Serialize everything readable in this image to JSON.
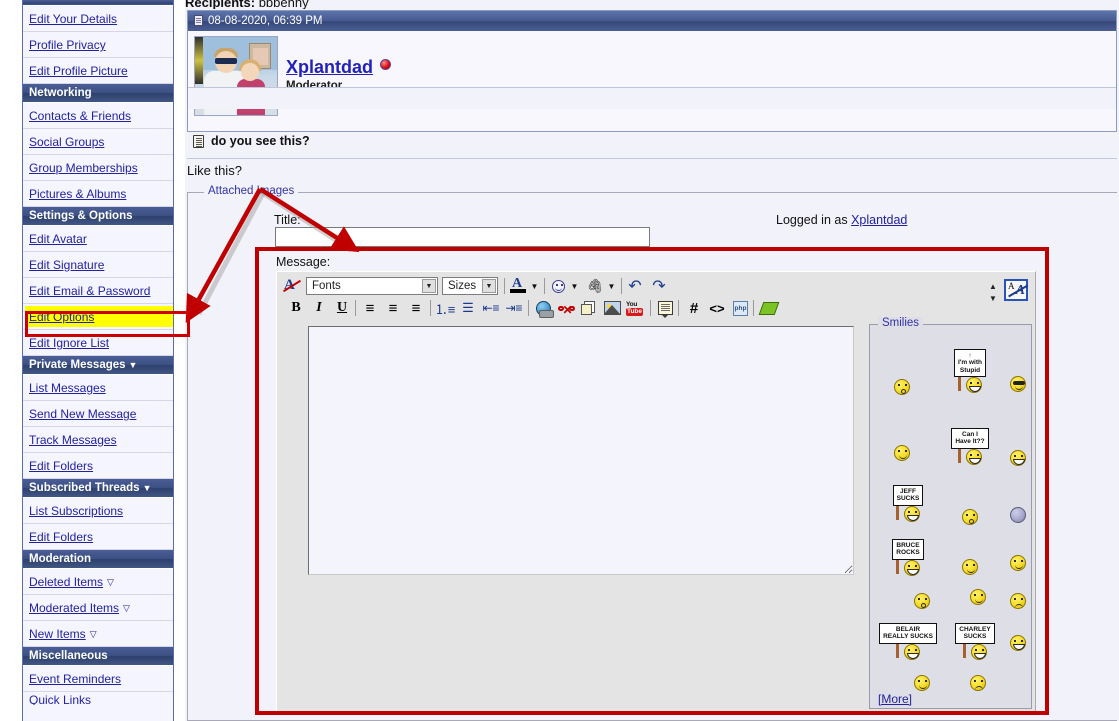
{
  "colors": {
    "nav_header_bg": "#3C5084",
    "link": "#22229C",
    "highlight": "#FFFF00",
    "annotation_red": "#C00000",
    "panel_bg": "#F2F2FA"
  },
  "sidebar": {
    "groups": [
      {
        "header": null,
        "items": [
          {
            "label": "Edit Your Details"
          },
          {
            "label": "Profile Privacy"
          },
          {
            "label": "Edit Profile Picture"
          }
        ]
      },
      {
        "header": "Networking",
        "caret": "",
        "items": [
          {
            "label": "Contacts & Friends"
          },
          {
            "label": "Social Groups"
          },
          {
            "label": "Group Memberships"
          },
          {
            "label": "Pictures & Albums"
          }
        ]
      },
      {
        "header": "Settings & Options",
        "caret": "",
        "items": [
          {
            "label": "Edit Avatar"
          },
          {
            "label": "Edit Signature"
          },
          {
            "label": "Edit Email & Password"
          },
          {
            "label": "Edit Options",
            "highlighted": true
          },
          {
            "label": "Edit Ignore List"
          }
        ]
      },
      {
        "header": "Private Messages",
        "caret": "▼",
        "items": [
          {
            "label": "List Messages"
          },
          {
            "label": "Send New Message"
          },
          {
            "label": "Track Messages"
          },
          {
            "label": "Edit Folders"
          }
        ]
      },
      {
        "header": "Subscribed Threads",
        "caret": "▼",
        "items": [
          {
            "label": "List Subscriptions"
          },
          {
            "label": "Edit Folders"
          }
        ]
      },
      {
        "header": "Moderation",
        "caret": "",
        "items": [
          {
            "label": "Deleted Items",
            "tri": "▽"
          },
          {
            "label": "Moderated Items",
            "tri": "▽"
          },
          {
            "label": "New Items",
            "tri": "▽"
          }
        ]
      },
      {
        "header": "Miscellaneous",
        "caret": "",
        "items": [
          {
            "label": "Event Reminders"
          },
          {
            "label": "Quick Links",
            "partial": true
          }
        ]
      }
    ]
  },
  "recipients": {
    "label": "Recipients",
    "value": "bbbenny"
  },
  "post": {
    "timestamp": "08-08-2020, 06:39 PM",
    "author": "Xplantdad",
    "user_title": "Moderator",
    "status": "online-dot",
    "body_text": "do you see this?"
  },
  "like_this": "Like this?",
  "attached": {
    "legend": "Attached Images",
    "title_label": "Title:",
    "title_value": "",
    "title_placeholder": "",
    "logged_in_prefix": "Logged in as",
    "logged_in_user": "Xplantdad",
    "message_label": "Message:",
    "message_value": ""
  },
  "toolbar": {
    "row1": [
      {
        "name": "remove-formatting-icon",
        "type": "icon-removefmt",
        "label": ""
      },
      {
        "name": "font-family-select",
        "type": "combo",
        "label": "Fonts"
      },
      {
        "name": "font-size-select",
        "type": "combo",
        "label": "Sizes"
      },
      {
        "name": "font-color-icon",
        "type": "icon-fontcolor",
        "label": ""
      },
      {
        "name": "smilies-icon",
        "type": "icon-smiley",
        "label": ""
      },
      {
        "name": "attachment-icon",
        "type": "icon-clip",
        "label": ""
      },
      {
        "name": "undo-icon",
        "type": "glyph",
        "label": "↶"
      },
      {
        "name": "redo-icon",
        "type": "glyph",
        "label": "↷"
      },
      {
        "name": "toggle-size-icon",
        "type": "updown",
        "label": "↕"
      },
      {
        "name": "toggle-editor-mode-icon",
        "type": "icon-AA",
        "label": ""
      }
    ],
    "row2": [
      {
        "name": "bold-icon",
        "label": "B"
      },
      {
        "name": "italic-icon",
        "label": "I"
      },
      {
        "name": "underline-icon",
        "label": "U"
      },
      {
        "name": "align-left-icon",
        "label": "≡"
      },
      {
        "name": "align-center-icon",
        "label": "≡"
      },
      {
        "name": "align-right-icon",
        "label": "≡"
      },
      {
        "name": "ordered-list-icon",
        "label": ""
      },
      {
        "name": "unordered-list-icon",
        "label": ""
      },
      {
        "name": "outdent-icon",
        "label": ""
      },
      {
        "name": "indent-icon",
        "label": ""
      },
      {
        "name": "insert-link-icon",
        "label": ""
      },
      {
        "name": "remove-link-icon",
        "label": ""
      },
      {
        "name": "insert-email-icon",
        "label": ""
      },
      {
        "name": "insert-image-icon",
        "label": ""
      },
      {
        "name": "insert-youtube-icon",
        "label": ""
      },
      {
        "name": "insert-quote-icon",
        "label": ""
      },
      {
        "name": "insert-hash-icon",
        "label": "#"
      },
      {
        "name": "insert-code-icon",
        "label": "<>"
      },
      {
        "name": "insert-php-icon",
        "label": ""
      },
      {
        "name": "insert-highlight-icon",
        "label": ""
      }
    ]
  },
  "smilies": {
    "legend": "Smilies",
    "more_label": "[More]",
    "grid": [
      [
        {
          "kind": "face",
          "variant": "omouth",
          "name": "smiley-confused"
        },
        {
          "kind": "sign",
          "text": "↑\nI'm with\nStupid",
          "name": "smiley-im-with-stupid"
        },
        {
          "kind": "face",
          "variant": "shades",
          "name": "smiley-cool"
        }
      ],
      [
        {
          "kind": "face",
          "variant": "cry",
          "name": "smiley-crying"
        },
        {
          "kind": "sign",
          "text": "Can I\nHave It??",
          "name": "smiley-can-i-have-it"
        },
        {
          "kind": "face",
          "variant": "grin",
          "name": "smiley-big-grin"
        }
      ],
      [
        {
          "kind": "sign",
          "text": "JEFF\nSUCKS",
          "name": "smiley-jeff-sucks"
        },
        {
          "kind": "face",
          "variant": "omouth",
          "name": "smiley-shocked"
        },
        {
          "kind": "gray",
          "variant": "",
          "name": "smiley-gray-blob"
        }
      ],
      [
        {
          "kind": "sign",
          "text": "BRUCE\nROCKS",
          "name": "smiley-bruce-rocks"
        },
        {
          "kind": "face",
          "variant": "flanked",
          "name": "smiley-flanked"
        },
        {
          "kind": "face",
          "variant": "cheer",
          "name": "smiley-cheering"
        }
      ],
      [
        {
          "kind": "face",
          "variant": "omouth",
          "name": "smiley-surprised"
        },
        {
          "kind": "face",
          "variant": "thumbsdown",
          "name": "smiley-thumbs-down"
        },
        {
          "kind": "face",
          "variant": "sad",
          "name": "smiley-unhappy"
        }
      ],
      [
        {
          "kind": "sign",
          "text": "BELAIR\nREALLY SUCKS",
          "name": "smiley-belair-really-sucks"
        },
        {
          "kind": "sign",
          "text": "CHARLEY\nSUCKS",
          "name": "smiley-charley-sucks"
        },
        {
          "kind": "face",
          "variant": "grin",
          "name": "smiley-laugh"
        }
      ],
      [
        {
          "kind": "face",
          "variant": "smile",
          "name": "smiley-happy"
        },
        {
          "kind": "face",
          "variant": "question",
          "name": "smiley-questioning"
        },
        {
          "kind": "blank",
          "variant": "",
          "name": "smiley-blank"
        }
      ]
    ]
  }
}
